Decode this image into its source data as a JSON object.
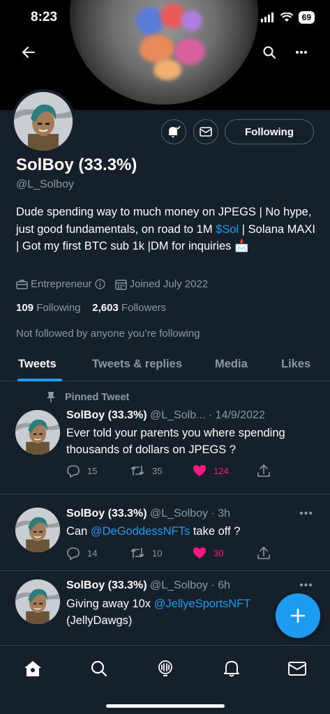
{
  "status_bar": {
    "time": "8:23",
    "battery": "69"
  },
  "profile": {
    "name": "SolBoy (33.3%)",
    "handle": "@L_Solboy",
    "follow_button": "Following",
    "bio_part1": "Dude spending way to much money on JPEGS | No hype, just good fundamentals, on road to 1M ",
    "bio_link": "$Sol",
    "bio_part2": " | Solana MAXI | Got my first BTC sub 1k |DM for inquiries ",
    "bio_emoji": "📩",
    "category": "Entrepreneur",
    "joined": "Joined July 2022",
    "following_count": "109",
    "following_label": "Following",
    "followers_count": "2,603",
    "followers_label": "Followers",
    "not_followed_text": "Not followed by anyone you’re following"
  },
  "tabs": [
    {
      "label": "Tweets"
    },
    {
      "label": "Tweets & replies"
    },
    {
      "label": "Media"
    },
    {
      "label": "Likes"
    }
  ],
  "tweets": [
    {
      "pinned_label": "Pinned Tweet",
      "name": "SolBoy (33.3%)",
      "handle_time": "@L_Solb... · 14/9/2022",
      "text": "Ever told your parents you where spending thousands of dollars on JPEGS ?",
      "replies": "15",
      "retweets": "35",
      "likes": "124"
    },
    {
      "name": "SolBoy (33.3%)",
      "handle_time": "@L_Solboy · 3h",
      "text_before": "Can ",
      "text_link": "@DeGoddessNFTs",
      "text_after": " take off ?",
      "replies": "14",
      "retweets": "10",
      "likes": "30"
    },
    {
      "name": "SolBoy (33.3%)",
      "handle_time": "@L_Solboy · 6h",
      "text_before": "Giving away 10x ",
      "text_link": "@JellyeSportsNFT",
      "text_after": "",
      "text_line2": "(JellyDawgs)"
    }
  ],
  "colors": {
    "background": "#15202b",
    "accent": "#1d9bf0",
    "like": "#f91880",
    "muted": "#8b98a5"
  }
}
